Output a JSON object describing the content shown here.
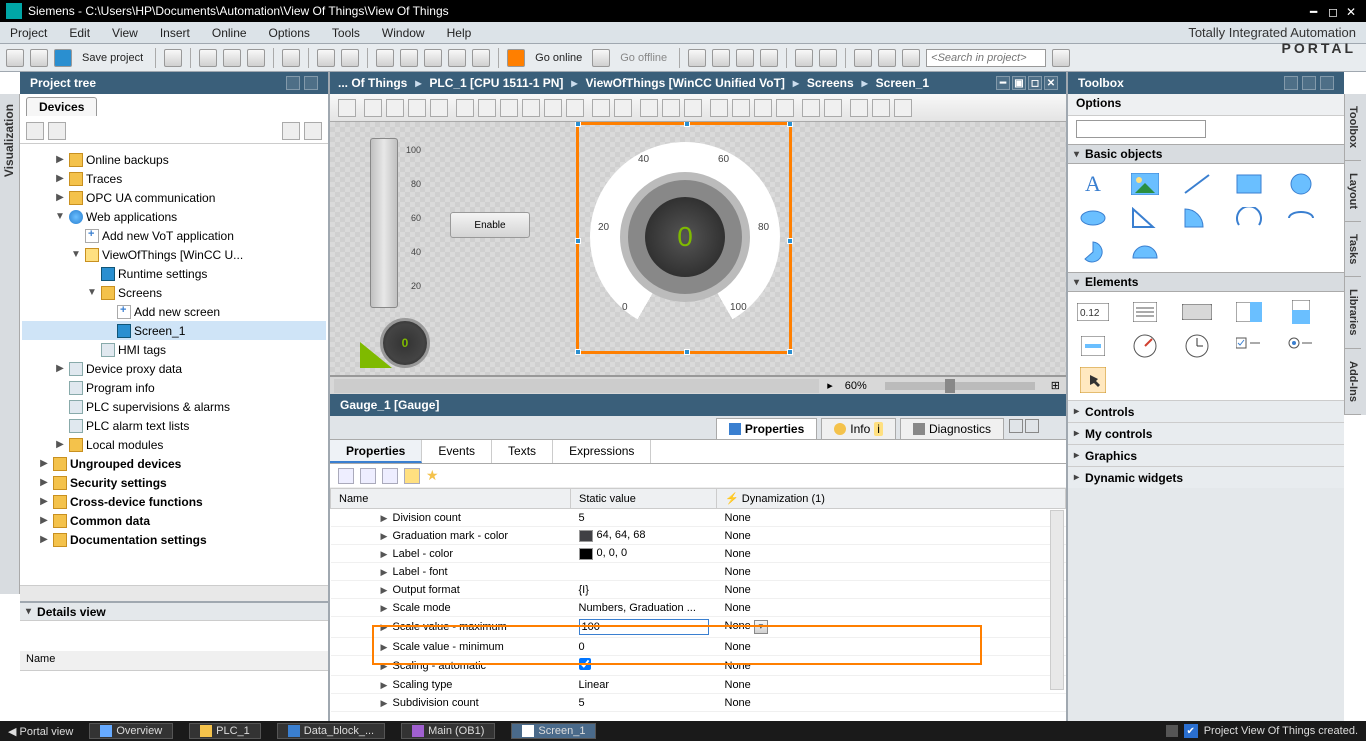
{
  "title": "Siemens  -  C:\\Users\\HP\\Documents\\Automation\\View Of Things\\View Of Things",
  "menu": [
    "Project",
    "Edit",
    "View",
    "Insert",
    "Online",
    "Options",
    "Tools",
    "Window",
    "Help"
  ],
  "tia": {
    "line1": "Totally Integrated Automation",
    "line2": "PORTAL"
  },
  "toolbar": {
    "save_label": "Save project",
    "go_online": "Go online",
    "go_offline": "Go offline",
    "search_placeholder": "<Search in project>"
  },
  "projecttree": {
    "title": "Project tree",
    "devices_tab": "Devices",
    "nodes": [
      {
        "indent": 2,
        "arrow": "▶",
        "icon": "ic-folder",
        "label": "Online backups"
      },
      {
        "indent": 2,
        "arrow": "▶",
        "icon": "ic-folder",
        "label": "Traces"
      },
      {
        "indent": 2,
        "arrow": "▶",
        "icon": "ic-folder",
        "label": "OPC UA communication"
      },
      {
        "indent": 2,
        "arrow": "▼",
        "icon": "ic-glob",
        "label": "Web applications"
      },
      {
        "indent": 3,
        "arrow": "",
        "icon": "ic-add",
        "label": "Add new VoT application"
      },
      {
        "indent": 3,
        "arrow": "▼",
        "icon": "ic-vot",
        "label": "ViewOfThings [WinCC U..."
      },
      {
        "indent": 4,
        "arrow": "",
        "icon": "ic-rt",
        "label": "Runtime settings"
      },
      {
        "indent": 4,
        "arrow": "▼",
        "icon": "ic-folder",
        "label": "Screens"
      },
      {
        "indent": 5,
        "arrow": "",
        "icon": "ic-add",
        "label": "Add new screen"
      },
      {
        "indent": 5,
        "arrow": "",
        "icon": "ic-screen",
        "label": "Screen_1",
        "selected": true
      },
      {
        "indent": 4,
        "arrow": "",
        "icon": "ic-file",
        "label": "HMI tags"
      },
      {
        "indent": 2,
        "arrow": "▶",
        "icon": "ic-file",
        "label": "Device proxy data"
      },
      {
        "indent": 2,
        "arrow": "",
        "icon": "ic-file",
        "label": "Program info"
      },
      {
        "indent": 2,
        "arrow": "",
        "icon": "ic-file",
        "label": "PLC supervisions & alarms"
      },
      {
        "indent": 2,
        "arrow": "",
        "icon": "ic-file",
        "label": "PLC alarm text lists"
      },
      {
        "indent": 2,
        "arrow": "▶",
        "icon": "ic-folder",
        "label": "Local modules"
      },
      {
        "indent": 1,
        "arrow": "▶",
        "icon": "ic-folder",
        "label": "Ungrouped devices",
        "bold": true
      },
      {
        "indent": 1,
        "arrow": "▶",
        "icon": "ic-folder",
        "label": "Security settings",
        "bold": true
      },
      {
        "indent": 1,
        "arrow": "▶",
        "icon": "ic-folder",
        "label": "Cross-device functions",
        "bold": true
      },
      {
        "indent": 1,
        "arrow": "▶",
        "icon": "ic-folder",
        "label": "Common data",
        "bold": true
      },
      {
        "indent": 1,
        "arrow": "▶",
        "icon": "ic-folder",
        "label": "Documentation settings",
        "bold": true
      }
    ],
    "details_title": "Details view",
    "details_col": "Name"
  },
  "breadcrumb": [
    "... Of Things",
    "PLC_1 [CPU 1511-1 PN]",
    "ViewOfThings [WinCC Unified VoT]",
    "Screens",
    "Screen_1"
  ],
  "canvas": {
    "slider_ticks": [
      "100",
      "80",
      "60",
      "40",
      "20"
    ],
    "small_gauge_value": "0",
    "enable_label": "Enable",
    "big_gauge_value": "0",
    "big_gauge_labels": {
      "l0": "0",
      "l20": "20",
      "l40": "40",
      "l60": "60",
      "l80": "80",
      "l100": "100"
    },
    "zoom": "60%"
  },
  "propbar": {
    "object": "Gauge_1 [Gauge]",
    "tabs": [
      "Properties",
      "Info",
      "Diagnostics"
    ],
    "subtabs": [
      "Properties",
      "Events",
      "Texts",
      "Expressions"
    ],
    "columns": [
      "Name",
      "Static value",
      "Dynamization (1)"
    ],
    "rows": [
      {
        "name": "Division count",
        "value": "5",
        "dyn": "None"
      },
      {
        "name": "Graduation mark - color",
        "value": "64, 64, 68",
        "swatch": "#404044",
        "dyn": "None"
      },
      {
        "name": "Label - color",
        "value": "0, 0, 0",
        "swatch": "#000000",
        "dyn": "None"
      },
      {
        "name": "Label - font",
        "value": "",
        "dyn": "None"
      },
      {
        "name": "Output format",
        "value": "{I}",
        "dyn": "None"
      },
      {
        "name": "Scale mode",
        "value": "Numbers, Graduation ...",
        "dyn": "None"
      },
      {
        "name": "Scale value - maximum",
        "value": "100",
        "dyn": "None",
        "editing": true,
        "hl": true,
        "dd": true
      },
      {
        "name": "Scale value - minimum",
        "value": "0",
        "dyn": "None",
        "hl": true
      },
      {
        "name": "Scaling - automatic",
        "value": "",
        "check": true,
        "dyn": "None"
      },
      {
        "name": "Scaling type",
        "value": "Linear",
        "dyn": "None"
      },
      {
        "name": "Subdivision count",
        "value": "5",
        "dyn": "None"
      }
    ]
  },
  "toolbox": {
    "title": "Toolbox",
    "options": "Options",
    "sections": {
      "basic": "Basic objects",
      "elements": "Elements",
      "collapsed": [
        "Controls",
        "My controls",
        "Graphics",
        "Dynamic widgets"
      ]
    }
  },
  "vtabs_right": [
    "Toolbox",
    "Layout",
    "Tasks",
    "Libraries",
    "Add-Ins"
  ],
  "vtab_left": "Visualization",
  "bottombar": {
    "portal": "Portal view",
    "tabs": [
      "Overview",
      "PLC_1",
      "Data_block_...",
      "Main (OB1)",
      "Screen_1"
    ],
    "status": "Project View Of Things created."
  }
}
